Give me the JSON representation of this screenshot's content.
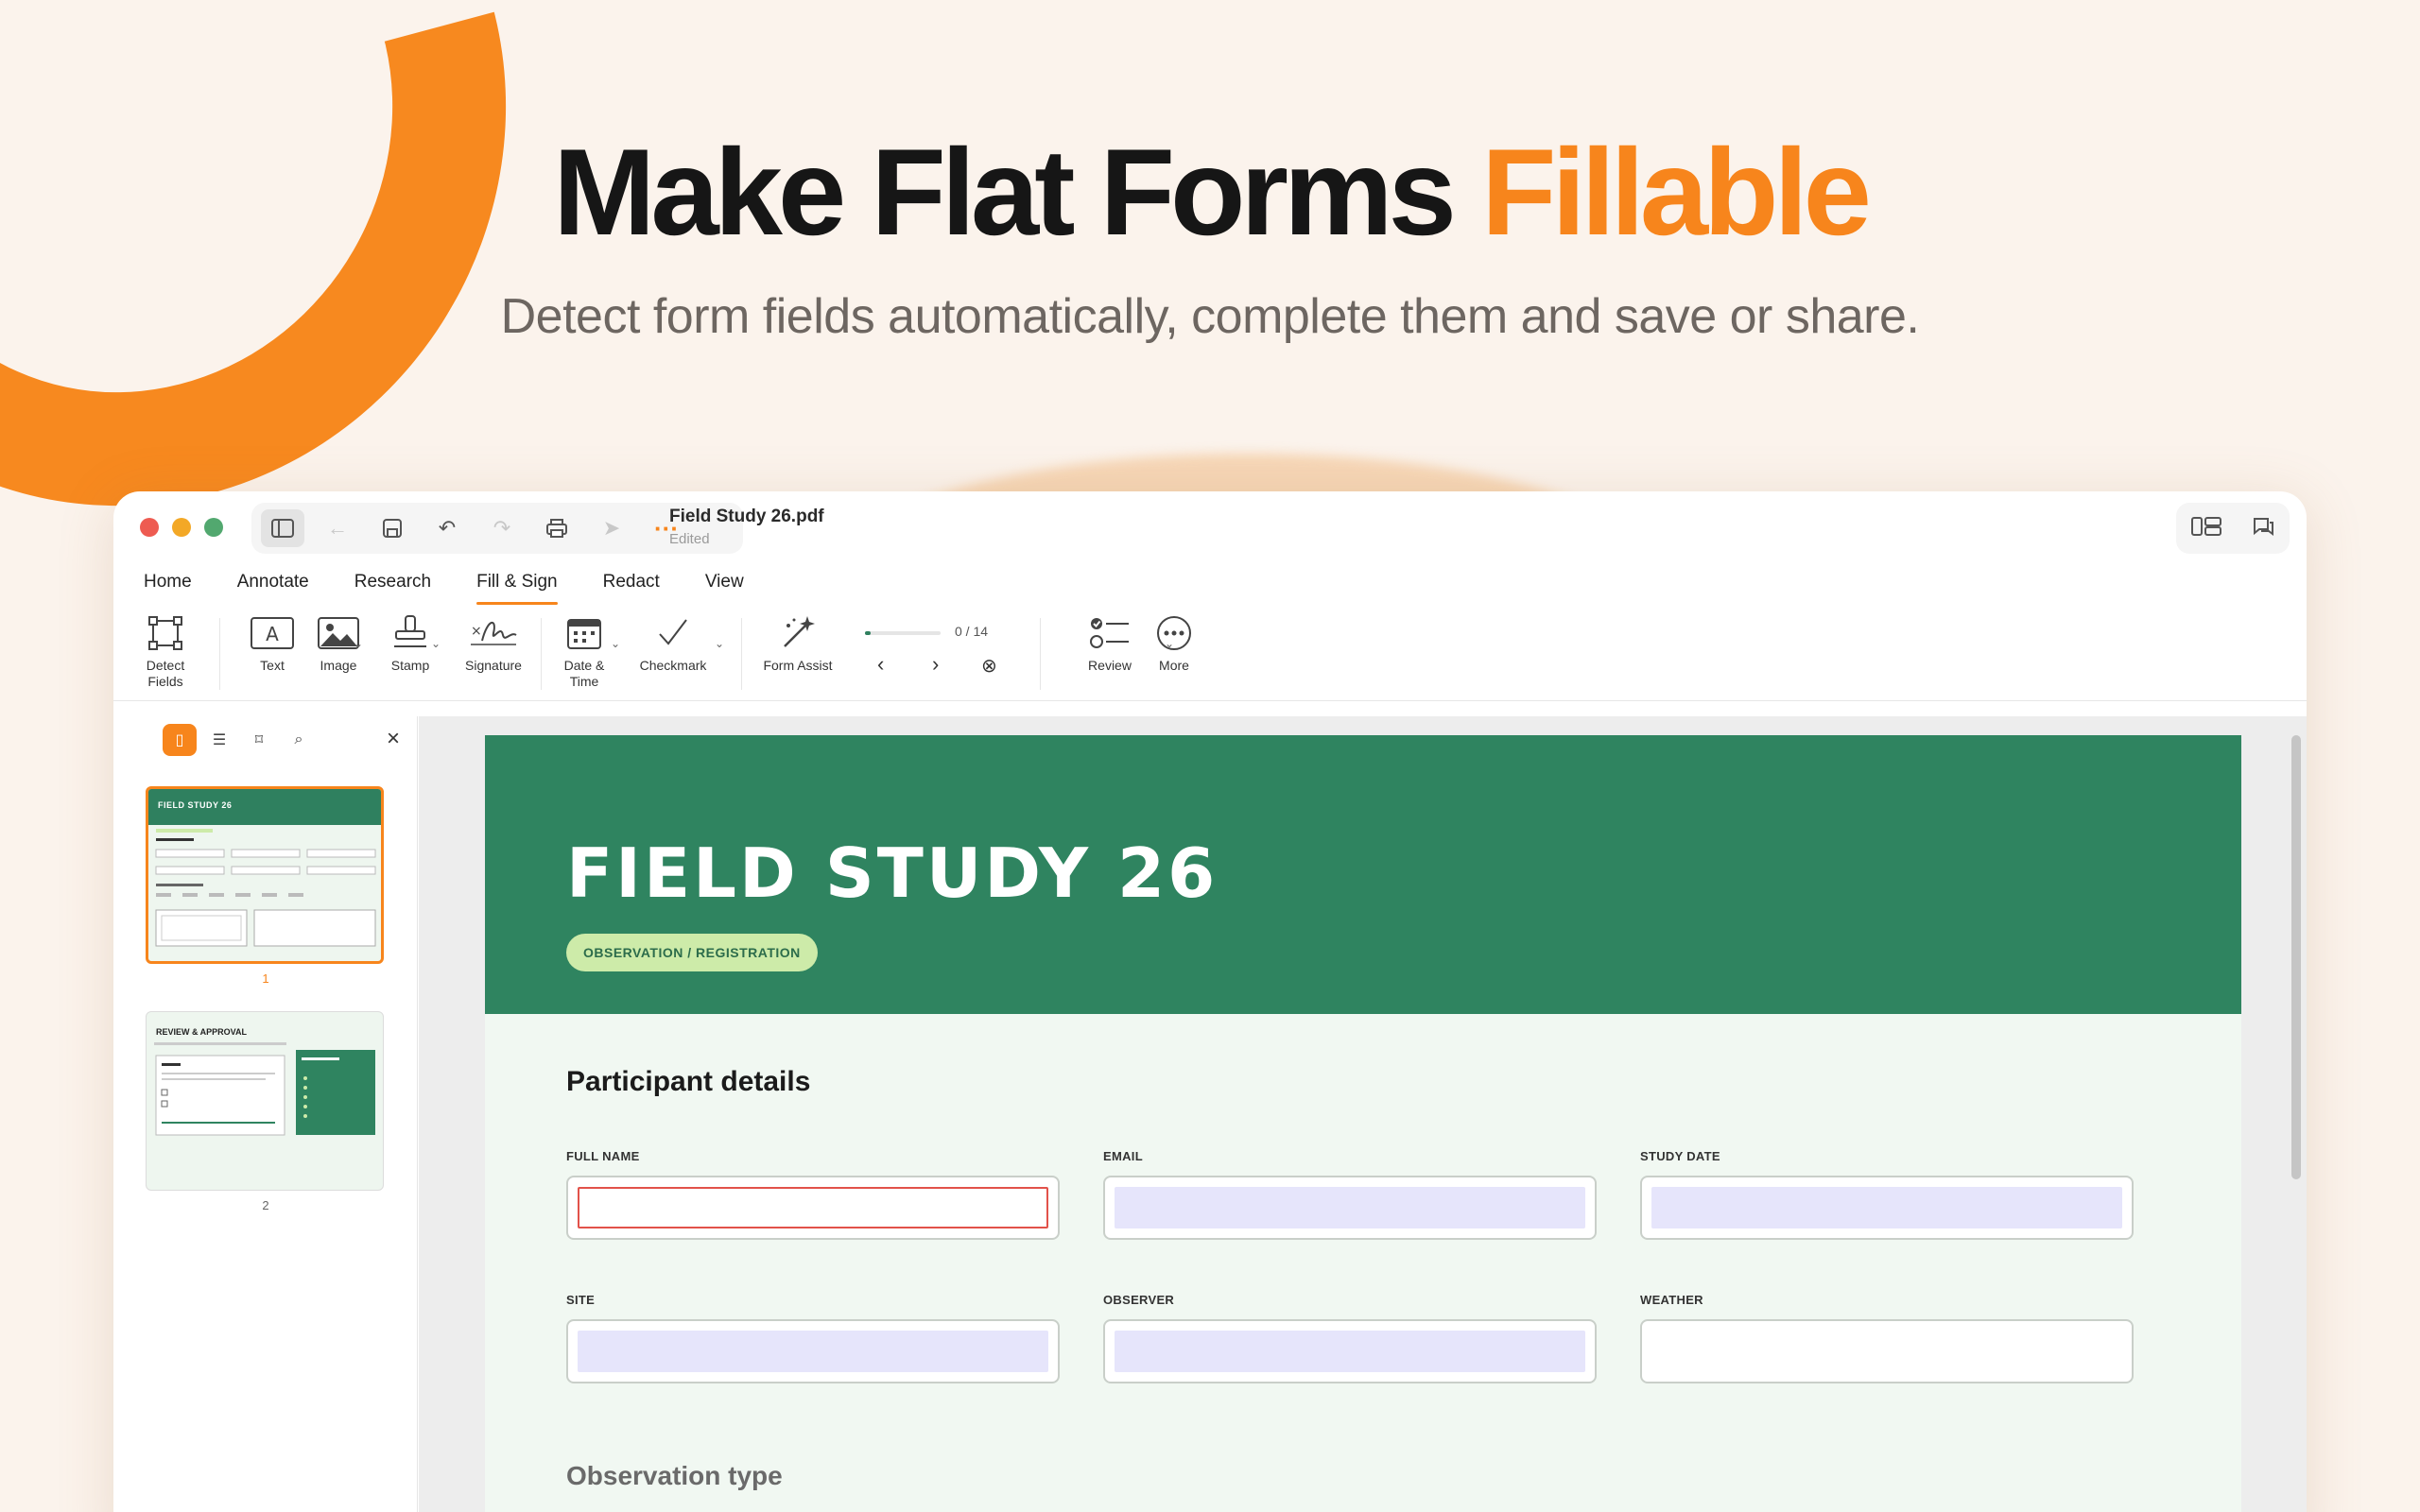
{
  "hero": {
    "title_main": "Make Flat Forms",
    "title_accent": "Fillable",
    "subtitle": "Detect form fields automatically, complete them and save or share."
  },
  "window": {
    "doc_title": "Field Study 26.pdf",
    "doc_status": "Edited"
  },
  "menu": {
    "items": [
      "Home",
      "Annotate",
      "Research",
      "Fill & Sign",
      "Redact",
      "View"
    ],
    "active": "Fill & Sign"
  },
  "ribbon": {
    "detect_fields": "Detect\nFields",
    "text": "Text",
    "image": "Image",
    "stamp": "Stamp",
    "signature": "Signature",
    "date_time": "Date &\nTime",
    "checkmark": "Checkmark",
    "form_assist": "Form Assist",
    "progress_count": "0 / 14",
    "progress_fraction": 0.08,
    "review": "Review",
    "more": "More"
  },
  "sidebar": {
    "thumb1_title": "FIELD STUDY 26",
    "thumb1_num": "1",
    "thumb2_title": "REVIEW & APPROVAL",
    "thumb2_num": "2"
  },
  "page": {
    "banner_title": "FIELD STUDY 26",
    "banner_tag": "OBSERVATION / REGISTRATION",
    "section1": "Participant details",
    "fields": {
      "full_name": "FULL NAME",
      "email": "EMAIL",
      "study_date": "STUDY DATE",
      "site": "SITE",
      "observer": "OBSERVER",
      "weather": "WEATHER"
    },
    "section2": "Observation type"
  },
  "colors": {
    "accent": "#f7851c",
    "banner": "#2f8460",
    "field_fill": "#e6e5fb",
    "active_field": "#e2524a"
  }
}
